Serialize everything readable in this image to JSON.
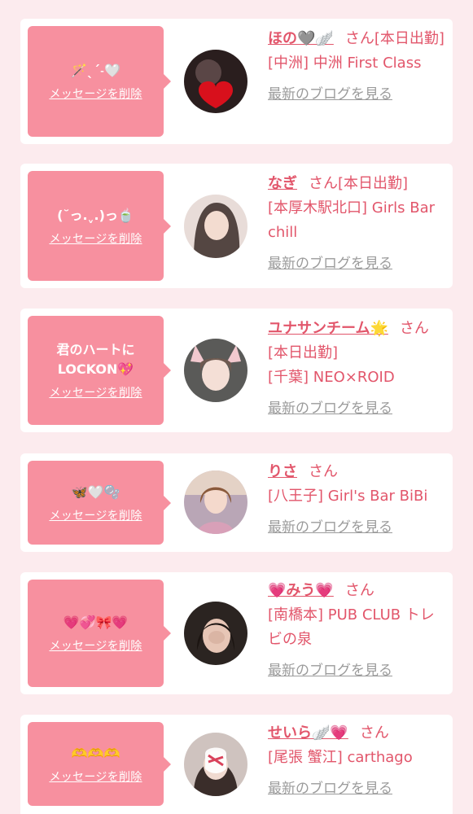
{
  "delete_label": "メッセージを削除",
  "san_label": "さん",
  "blog_label": "最新のブログを見る",
  "colors": {
    "background": "#fcebee",
    "card": "#ffffff",
    "bubble": "#f7909f",
    "name": "#e2566b",
    "link_gray": "#9b9b9b"
  },
  "cards": [
    {
      "message": "🪄ˎˊ˗🤍",
      "name": "ほの🩶🪽",
      "status": "[本日出勤]",
      "shop": "[中洲] 中洲 First Class"
    },
    {
      "message": "(˘っ.ˬ.)っ🍵",
      "name": "なぎ",
      "status": "[本日出勤]",
      "shop": "[本厚木駅北口] Girls Bar chill"
    },
    {
      "message": "君のハートに\nLOCKON💖",
      "name": "ユナサンチーム🌟",
      "status": "[本日出勤]",
      "shop": "[千葉] NEO×ROID"
    },
    {
      "message": "🦋🤍🫧",
      "name": "りさ",
      "status": "",
      "shop": "[八王子] Girl's Bar BiBi"
    },
    {
      "message": "💗💞🎀💗",
      "name": "💗みう💗",
      "status": "",
      "shop": "[南橋本] PUB CLUB トレビの泉"
    },
    {
      "message": "🫶🫶🫶",
      "name": "せいら🪽💗",
      "status": "",
      "shop": "[尾張 蟹江] carthago"
    }
  ]
}
